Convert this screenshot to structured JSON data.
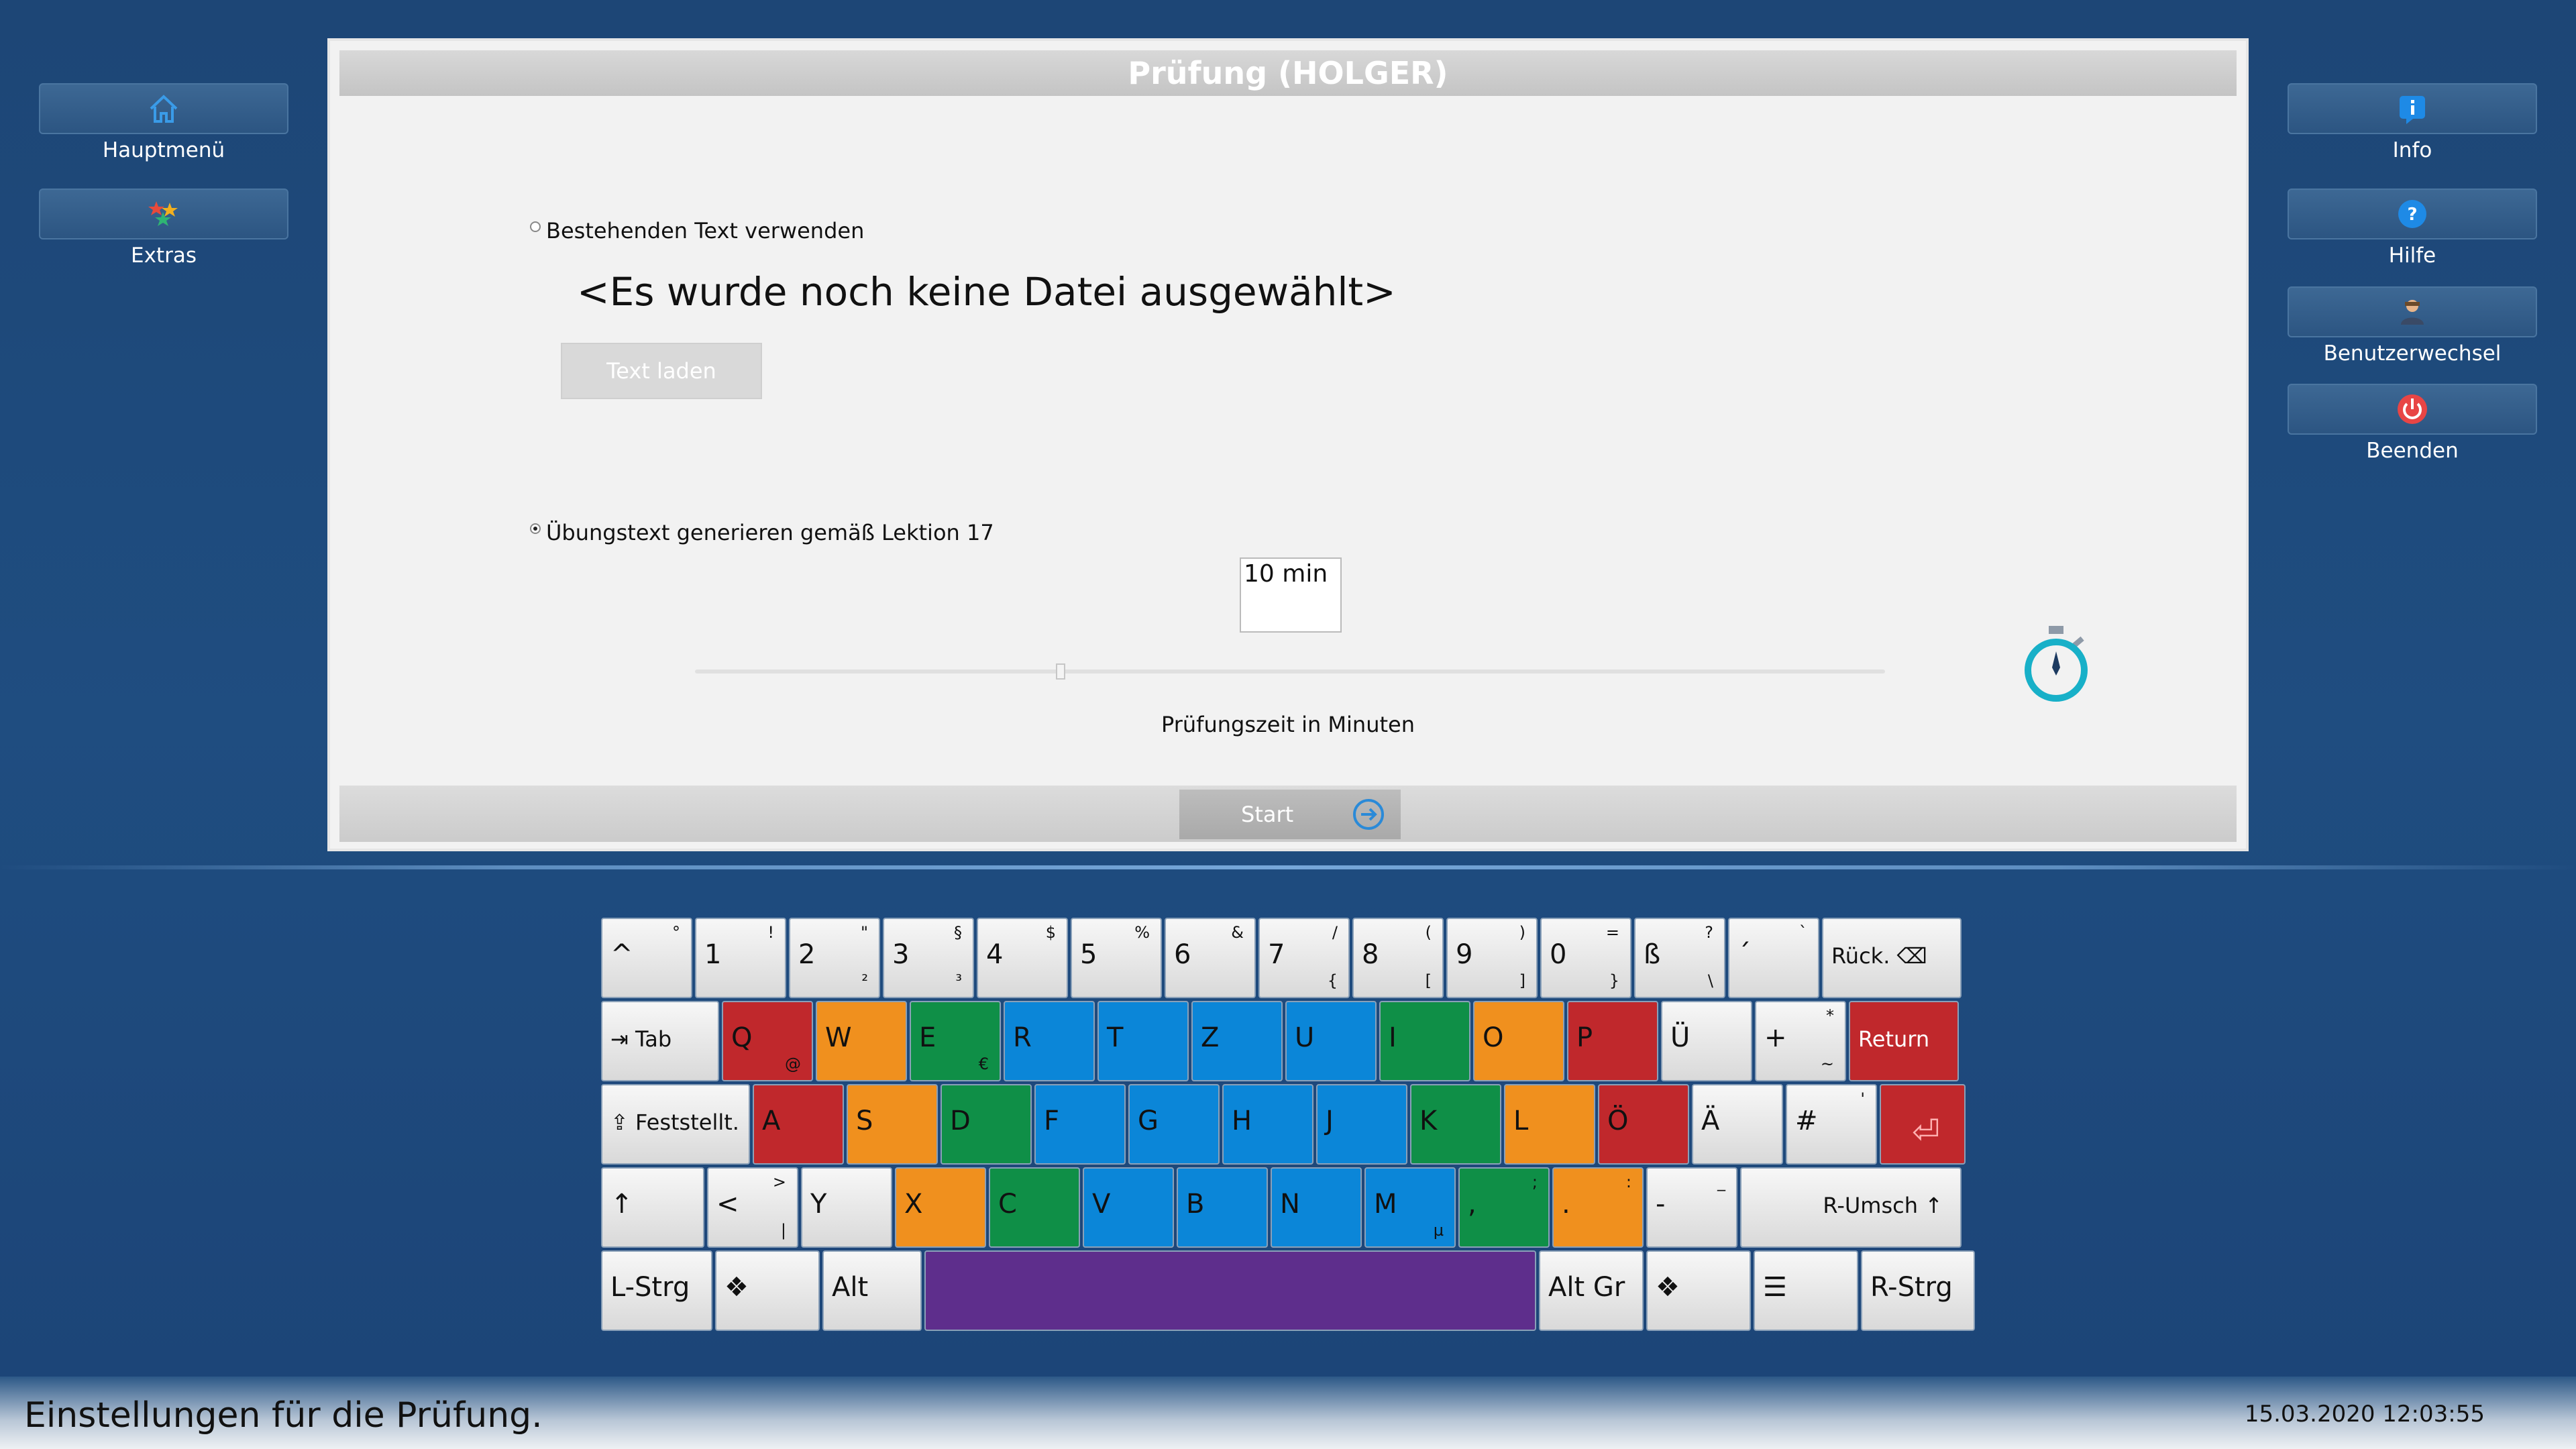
{
  "sidebar_left": [
    {
      "label": "Hauptmenü",
      "icon": "home-icon"
    },
    {
      "label": "Extras",
      "icon": "stars-icon"
    }
  ],
  "sidebar_right": [
    {
      "label": "Info",
      "icon": "info-icon"
    },
    {
      "label": "Hilfe",
      "icon": "help-icon"
    },
    {
      "label": "Benutzerwechsel",
      "icon": "user-icon"
    },
    {
      "label": "Beenden",
      "icon": "power-icon"
    }
  ],
  "dialog": {
    "title": "Prüfung (HOLGER)",
    "option_existing": "Bestehenden Text verwenden",
    "file_label": "<Es wurde noch keine Datei ausgewählt>",
    "load_button": "Text laden",
    "option_generate": "Übungstext generieren gemäß Lektion 17",
    "minutes_value": "10 min",
    "slider_value_minutes": 10,
    "slider_label": "Prüfungszeit in Minuten",
    "start_button": "Start"
  },
  "keyboard": {
    "row1": [
      {
        "main": "^",
        "sub": "°"
      },
      {
        "main": "1",
        "sub": "!"
      },
      {
        "main": "2",
        "sub": "\"",
        "sub2": "²"
      },
      {
        "main": "3",
        "sub": "§",
        "sub2": "³"
      },
      {
        "main": "4",
        "sub": "$"
      },
      {
        "main": "5",
        "sub": "%"
      },
      {
        "main": "6",
        "sub": "&"
      },
      {
        "main": "7",
        "sub": "/",
        "sub2": "{"
      },
      {
        "main": "8",
        "sub": "(",
        "sub2": "["
      },
      {
        "main": "9",
        "sub": ")",
        "sub2": "]"
      },
      {
        "main": "0",
        "sub": "=",
        "sub2": "}"
      },
      {
        "main": "ß",
        "sub": "?",
        "sub2": "\\"
      },
      {
        "main": "´",
        "sub": "`"
      },
      {
        "main": "Rück.  ⌫",
        "sub": ""
      }
    ],
    "row2": [
      {
        "main": "⇥ Tab"
      },
      {
        "main": "Q",
        "sub2": "@"
      },
      {
        "main": "W"
      },
      {
        "main": "E",
        "sub2": "€"
      },
      {
        "main": "R"
      },
      {
        "main": "T"
      },
      {
        "main": "Z"
      },
      {
        "main": "U"
      },
      {
        "main": "I"
      },
      {
        "main": "O"
      },
      {
        "main": "P"
      },
      {
        "main": "Ü"
      },
      {
        "main": "+",
        "sub": "*",
        "sub2": "~"
      },
      {
        "main": "Return"
      }
    ],
    "row3": [
      {
        "main": "⇪ Feststellt."
      },
      {
        "main": "A"
      },
      {
        "main": "S"
      },
      {
        "main": "D"
      },
      {
        "main": "F"
      },
      {
        "main": "G"
      },
      {
        "main": "H"
      },
      {
        "main": "J"
      },
      {
        "main": "K"
      },
      {
        "main": "L"
      },
      {
        "main": "Ö"
      },
      {
        "main": "Ä"
      },
      {
        "main": "#",
        "sub": "'"
      },
      {
        "main": "⏎"
      }
    ],
    "row4": [
      {
        "main": "↑"
      },
      {
        "main": "<",
        "sub": ">",
        "sub2": "|"
      },
      {
        "main": "Y"
      },
      {
        "main": "X"
      },
      {
        "main": "C"
      },
      {
        "main": "V"
      },
      {
        "main": "B"
      },
      {
        "main": "N"
      },
      {
        "main": "M",
        "sub2": "µ"
      },
      {
        "main": ",",
        "sub": ";"
      },
      {
        "main": ".",
        "sub": ":"
      },
      {
        "main": "-",
        "sub": "_"
      },
      {
        "main": "R-Umsch ↑"
      }
    ],
    "row5": [
      {
        "main": "L-Strg"
      },
      {
        "main": "❖"
      },
      {
        "main": "Alt"
      },
      {
        "main": ""
      },
      {
        "main": "Alt Gr"
      },
      {
        "main": "❖"
      },
      {
        "main": "☰"
      },
      {
        "main": "R-Strg"
      }
    ]
  },
  "status": {
    "text": "Einstellungen für die Prüfung.",
    "datetime": "15.03.2020 12:03:55"
  }
}
